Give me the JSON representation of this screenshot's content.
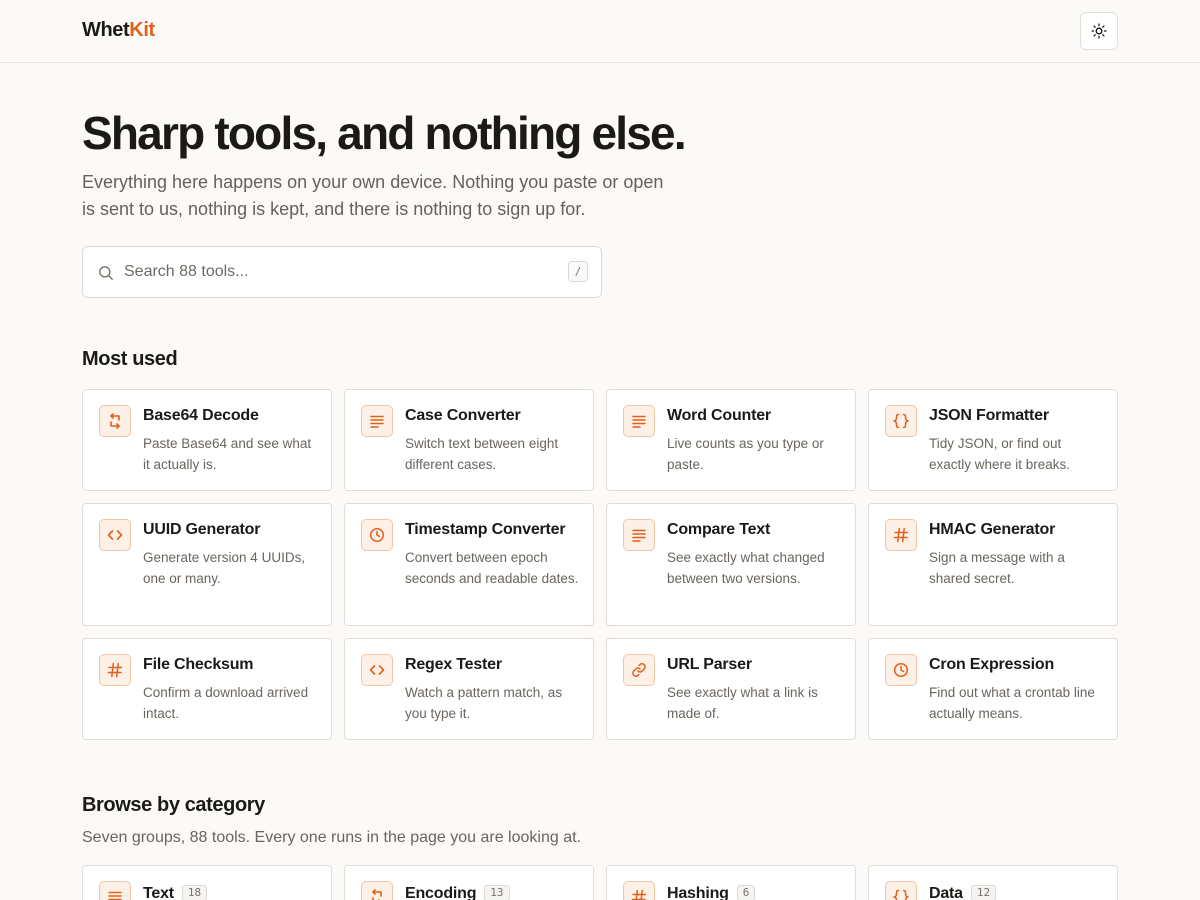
{
  "app": {
    "logo_part1": "Whet",
    "logo_part2": "Kit",
    "accent": "#e0601c",
    "theme_toggle_icon": "sun-icon"
  },
  "hero": {
    "title": "Sharp tools, and nothing else.",
    "subtitle": "Everything here happens on your own device. Nothing you paste or open is sent to us, nothing is kept, and there is nothing to sign up for."
  },
  "search": {
    "placeholder": "Search 88 tools...",
    "value": "",
    "shortcut": "/"
  },
  "most_used": {
    "heading": "Most used",
    "tools": [
      {
        "title": "Base64 Decode",
        "desc": "Paste Base64 and see what it actually is.",
        "icon": "swap-arrows-icon"
      },
      {
        "title": "Case Converter",
        "desc": "Switch text between eight different cases.",
        "icon": "text-lines-icon"
      },
      {
        "title": "Word Counter",
        "desc": "Live counts as you type or paste.",
        "icon": "text-lines-icon"
      },
      {
        "title": "JSON Formatter",
        "desc": "Tidy JSON, or find out exactly where it breaks.",
        "icon": "braces-icon"
      },
      {
        "title": "UUID Generator",
        "desc": "Generate version 4 UUIDs, one or many.",
        "icon": "code-brackets-icon"
      },
      {
        "title": "Timestamp Converter",
        "desc": "Convert between epoch seconds and readable dates.",
        "icon": "clock-icon"
      },
      {
        "title": "Compare Text",
        "desc": "See exactly what changed between two versions.",
        "icon": "text-lines-icon"
      },
      {
        "title": "HMAC Generator",
        "desc": "Sign a message with a shared secret.",
        "icon": "hash-icon"
      },
      {
        "title": "File Checksum",
        "desc": "Confirm a download arrived intact.",
        "icon": "hash-icon"
      },
      {
        "title": "Regex Tester",
        "desc": "Watch a pattern match, as you type it.",
        "icon": "code-brackets-icon"
      },
      {
        "title": "URL Parser",
        "desc": "See exactly what a link is made of.",
        "icon": "link-icon"
      },
      {
        "title": "Cron Expression",
        "desc": "Find out what a crontab line actually means.",
        "icon": "clock-icon"
      }
    ]
  },
  "categories": {
    "heading": "Browse by category",
    "subtitle": "Seven groups, 88 tools. Every one runs in the page you are looking at.",
    "items": [
      {
        "name": "Text",
        "count": "18",
        "icon": "text-lines-icon"
      },
      {
        "name": "Encoding",
        "count": "13",
        "icon": "swap-arrows-icon"
      },
      {
        "name": "Hashing",
        "count": "6",
        "icon": "hash-icon"
      },
      {
        "name": "Data",
        "count": "12",
        "icon": "braces-icon"
      }
    ]
  }
}
